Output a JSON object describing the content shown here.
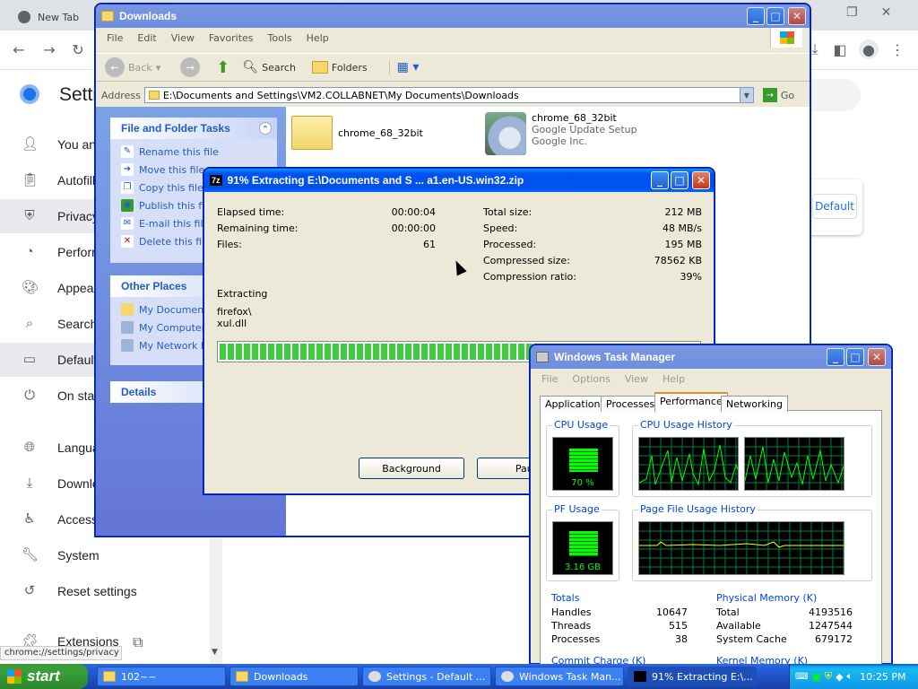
{
  "chrome": {
    "tab_title": "New Tab",
    "settings_title": "Settings",
    "status_url": "chrome://settings/privacy",
    "default_btn": "Default",
    "sidebar": [
      {
        "label": "You and Google",
        "icon": "person-icon"
      },
      {
        "label": "Autofill",
        "icon": "clipboard-icon"
      },
      {
        "label": "Privacy and security",
        "icon": "shield-icon",
        "selected": true
      },
      {
        "label": "Performance",
        "icon": "speedometer-icon"
      },
      {
        "label": "Appearance",
        "icon": "palette-icon"
      },
      {
        "label": "Search engine",
        "icon": "search-icon"
      },
      {
        "label": "Default browser",
        "icon": "browser-icon",
        "selected": true
      },
      {
        "label": "On startup",
        "icon": "power-icon"
      },
      {
        "label": "Languages",
        "icon": "globe-icon"
      },
      {
        "label": "Downloads",
        "icon": "download-icon"
      },
      {
        "label": "Accessibility",
        "icon": "accessibility-icon"
      },
      {
        "label": "System",
        "icon": "wrench-icon"
      },
      {
        "label": "Reset settings",
        "icon": "reset-icon"
      },
      {
        "label": "Extensions",
        "icon": "puzzle-icon"
      }
    ]
  },
  "explorer": {
    "title": "Downloads",
    "menu": [
      "File",
      "Edit",
      "View",
      "Favorites",
      "Tools",
      "Help"
    ],
    "toolbar": {
      "back": "Back",
      "search": "Search",
      "folders": "Folders"
    },
    "address_label": "Address",
    "address": "E:\\Documents and Settings\\VM2.COLLABNET\\My Documents\\Downloads",
    "go": "Go",
    "file_tasks_title": "File and Folder Tasks",
    "file_tasks": [
      "Rename this file",
      "Move this file",
      "Copy this file",
      "Publish this file to the Web",
      "E-mail this file",
      "Delete this file"
    ],
    "other_places_title": "Other Places",
    "other_places": [
      "My Documents",
      "My Computer",
      "My Network Places"
    ],
    "details_title": "Details",
    "files": [
      {
        "name": "chrome_68_32bit",
        "sub1": "",
        "sub2": ""
      },
      {
        "name": "chrome_68_32bit",
        "sub1": "Google Update Setup",
        "sub2": "Google Inc."
      }
    ]
  },
  "extract": {
    "title": "91% Extracting E:\\Documents and S ... a1.en-US.win32.zip",
    "left": [
      {
        "k": "Elapsed time:",
        "v": "00:00:04"
      },
      {
        "k": "Remaining time:",
        "v": "00:00:00"
      },
      {
        "k": "Files:",
        "v": "61"
      }
    ],
    "right": [
      {
        "k": "Total size:",
        "v": "212 MB"
      },
      {
        "k": "Speed:",
        "v": "48 MB/s"
      },
      {
        "k": "Processed:",
        "v": "195 MB"
      },
      {
        "k": "Compressed size:",
        "v": "78562 KB"
      },
      {
        "k": "Compression ratio:",
        "v": "39%"
      }
    ],
    "status_label": "Extracting",
    "current_dir": "firefox\\",
    "current_file": "xul.dll",
    "progress": 0.91,
    "btn_background": "Background",
    "btn_pause": "Pause"
  },
  "taskmgr": {
    "title": "Windows Task Manager",
    "menu": [
      "File",
      "Options",
      "View",
      "Help"
    ],
    "tabs": [
      "Applications",
      "Processes",
      "Performance",
      "Networking"
    ],
    "cpu_usage_label": "CPU Usage",
    "cpu_usage": "70 %",
    "cpu_history_label": "CPU Usage History",
    "pf_usage_label": "PF Usage",
    "pf_usage": "3.16 GB",
    "pf_history_label": "Page File Usage History",
    "totals_label": "Totals",
    "totals": [
      {
        "k": "Handles",
        "v": "10647"
      },
      {
        "k": "Threads",
        "v": "515"
      },
      {
        "k": "Processes",
        "v": "38"
      }
    ],
    "phys_label": "Physical Memory (K)",
    "phys": [
      {
        "k": "Total",
        "v": "4193516"
      },
      {
        "k": "Available",
        "v": "1247544"
      },
      {
        "k": "System Cache",
        "v": "679172"
      }
    ],
    "commit_label": "Commit Charge (K)",
    "kernel_label": "Kernel Memory (K)"
  },
  "taskbar": {
    "start": "start",
    "items": [
      "102~~",
      "Downloads",
      "Settings - Default ...",
      "Windows Task Man...",
      "91% Extracting E:\\..."
    ],
    "clock": "10:25 PM"
  }
}
